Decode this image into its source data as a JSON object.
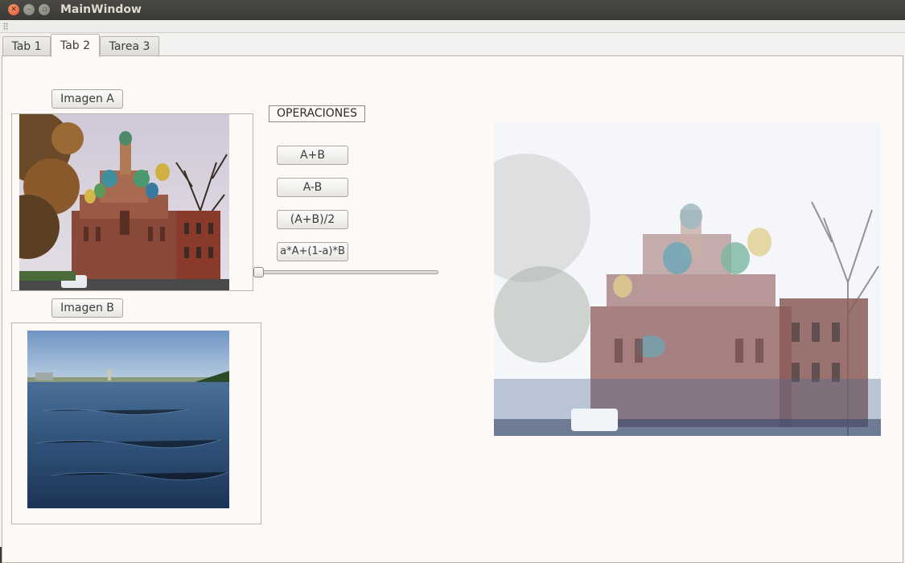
{
  "window": {
    "title": "MainWindow",
    "controls": [
      "close-icon",
      "minimize-icon",
      "maximize-icon"
    ]
  },
  "tabs": [
    {
      "label": "Tab 1",
      "active": false
    },
    {
      "label": "Tab 2",
      "active": true
    },
    {
      "label": "Tarea 3",
      "active": false
    }
  ],
  "image_a": {
    "button_label": "Imagen A"
  },
  "image_b": {
    "button_label": "Imagen B"
  },
  "operations": {
    "title": "OPERACIONES",
    "buttons": [
      "A+B",
      "A-B",
      "(A+B)/2",
      "a*A+(1-a)*B"
    ],
    "alpha_slider_value": 0
  },
  "colors": {
    "panel_bg": "#fcf9f7",
    "titlebar": "#3c3b37",
    "close_button": "#e0542c"
  }
}
